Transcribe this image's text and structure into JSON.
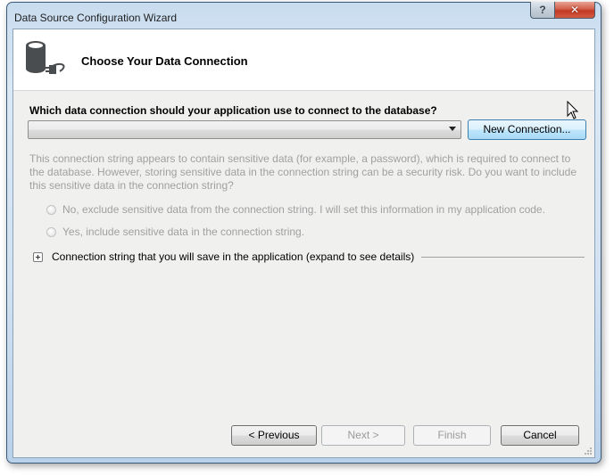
{
  "window": {
    "title": "Data Source Configuration Wizard",
    "help_button_label": "?",
    "close_button_label": "✕"
  },
  "header": {
    "icon": "database-connection-icon",
    "title": "Choose Your Data Connection"
  },
  "connection": {
    "question": "Which data connection should your application use to connect to the database?",
    "combo_value": "",
    "new_connection_label": "New Connection..."
  },
  "sensitive": {
    "description": "This connection string appears to contain sensitive data (for example, a password), which is required to connect to the database. However, storing sensitive data in the connection string can be a security risk. Do you want to include this sensitive data in the connection string?",
    "options": [
      {
        "label": "No, exclude sensitive data from the connection string. I will set this information in my application code.",
        "selected": false,
        "enabled": false
      },
      {
        "label": "Yes, include sensitive data in the connection string.",
        "selected": false,
        "enabled": false
      }
    ]
  },
  "expander": {
    "label": "Connection string that you will save in the application (expand to see details)",
    "expanded": false
  },
  "footer": {
    "previous_label": "< Previous",
    "next_label": "Next >",
    "finish_label": "Finish",
    "cancel_label": "Cancel"
  }
}
